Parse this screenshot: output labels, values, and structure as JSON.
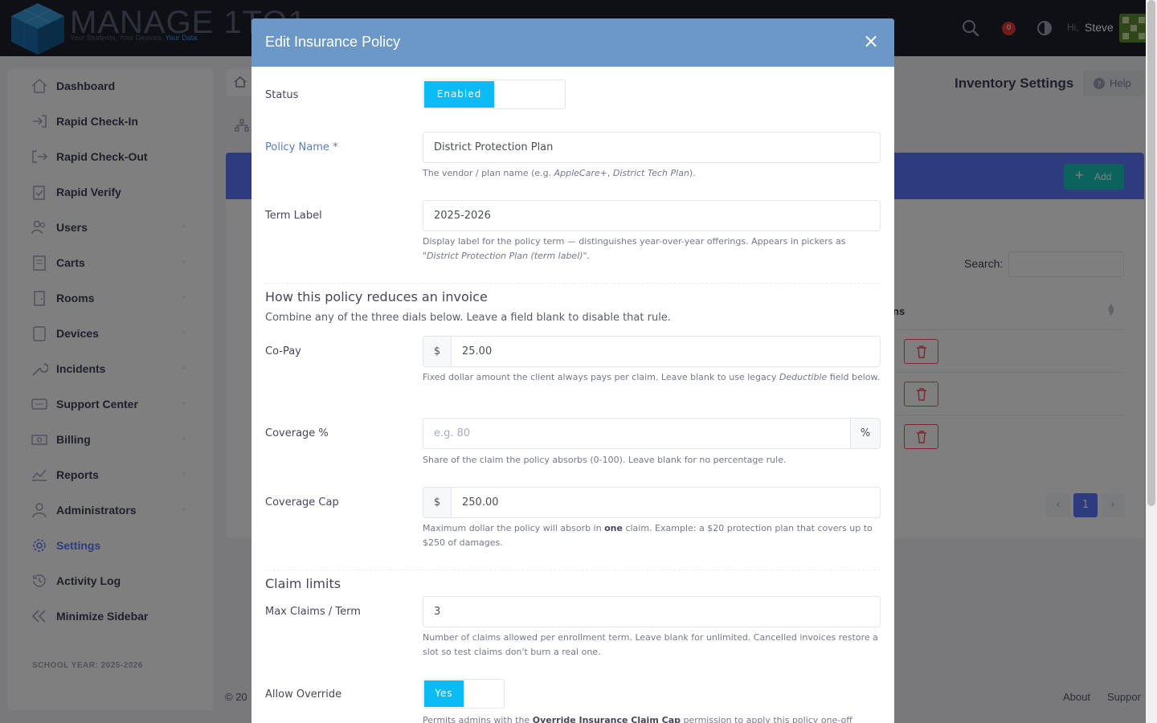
{
  "brand": {
    "name": "MANAGE 1TO1",
    "tagline_part1": "Your Students, Your Devices,",
    "tagline_part2": "Your Data"
  },
  "topbar": {
    "notification_count": "0",
    "greeting": "Hi,",
    "user_name": "Steve"
  },
  "sidebar": {
    "items": [
      {
        "label": "Dashboard",
        "icon": "dashboard-icon"
      },
      {
        "label": "Rapid Check-In",
        "icon": "check-in-icon"
      },
      {
        "label": "Rapid Check-Out",
        "icon": "check-out-icon"
      },
      {
        "label": "Rapid Verify",
        "icon": "clipboard-icon"
      },
      {
        "label": "Users",
        "icon": "users-icon"
      },
      {
        "label": "Carts",
        "icon": "cart-icon"
      },
      {
        "label": "Rooms",
        "icon": "door-icon"
      },
      {
        "label": "Devices",
        "icon": "device-icon"
      },
      {
        "label": "Incidents",
        "icon": "wrench-icon"
      },
      {
        "label": "Support Center",
        "icon": "support-icon"
      },
      {
        "label": "Billing",
        "icon": "money-icon"
      },
      {
        "label": "Reports",
        "icon": "chart-icon"
      },
      {
        "label": "Administrators",
        "icon": "admin-icon"
      },
      {
        "label": "Settings",
        "icon": "gear-icon"
      },
      {
        "label": "Activity Log",
        "icon": "history-icon"
      },
      {
        "label": "Minimize Sidebar",
        "icon": "double-chevron-left-icon"
      }
    ],
    "school_year": "SCHOOL YEAR: 2025-2026"
  },
  "page": {
    "title": "Inventory Settings",
    "help_label": "Help",
    "add_label": "Add",
    "search_label": "Search:",
    "column_header_partial": "ns",
    "current_page": "1",
    "footer_left": "© 20",
    "footer_links": [
      "About",
      "Suppor"
    ]
  },
  "modal": {
    "title": "Edit Insurance Policy",
    "close_glyph": "×",
    "status": {
      "label": "Status",
      "toggle_on": "Enabled"
    },
    "policy_name": {
      "label": "Policy Name *",
      "value": "District Protection Plan",
      "help_prefix": "The vendor / plan name (e.g. ",
      "help_ex1": "AppleCare+",
      "help_sep": ", ",
      "help_ex2": "District Tech Plan",
      "help_suffix": ")."
    },
    "term_label": {
      "label": "Term Label",
      "value": "2025-2026",
      "help": "Display label for the policy term — distinguishes year-over-year offerings. Appears in pickers as",
      "help_example": "\"District Protection Plan (term label)\"."
    },
    "reduce_section": {
      "title": "How this policy reduces an invoice",
      "desc": "Combine any of the three dials below. Leave a field blank to disable that rule."
    },
    "copay": {
      "label": "Co-Pay",
      "prefix": "$",
      "value": "25.00",
      "help_prefix": "Fixed dollar amount the client always pays per claim. Leave blank to use legacy ",
      "help_em": "Deductible",
      "help_suffix": " field below."
    },
    "coverage_pct": {
      "label": "Coverage %",
      "placeholder": "e.g. 80",
      "suffix": "%",
      "help": "Share of the claim the policy absorbs (0-100). Leave blank for no percentage rule."
    },
    "coverage_cap": {
      "label": "Coverage Cap",
      "prefix": "$",
      "value": "250.00",
      "help_prefix": "Maximum dollar the policy will absorb in ",
      "help_bold": "one",
      "help_suffix": " claim. Example: a $20 protection plan that covers up to $250 of damages."
    },
    "claim_section": {
      "title": "Claim limits"
    },
    "max_claims": {
      "label": "Max Claims / Term",
      "value": "3",
      "help": "Number of claims allowed per enrollment term. Leave blank for unlimited. Cancelled invoices restore a slot so test claims don't burn a real one."
    },
    "allow_override": {
      "label": "Allow Override",
      "toggle_on": "Yes",
      "help_prefix": "Permits admins with the ",
      "help_bold": "Override Insurance Claim Cap",
      "help_suffix": " permission to apply this policy one-off"
    }
  },
  "colors": {
    "modal_header": "#6c98c7",
    "toggle_on": "#0abbf5",
    "accent": "#5d78ff",
    "sidebar_text": "#3f4254"
  }
}
